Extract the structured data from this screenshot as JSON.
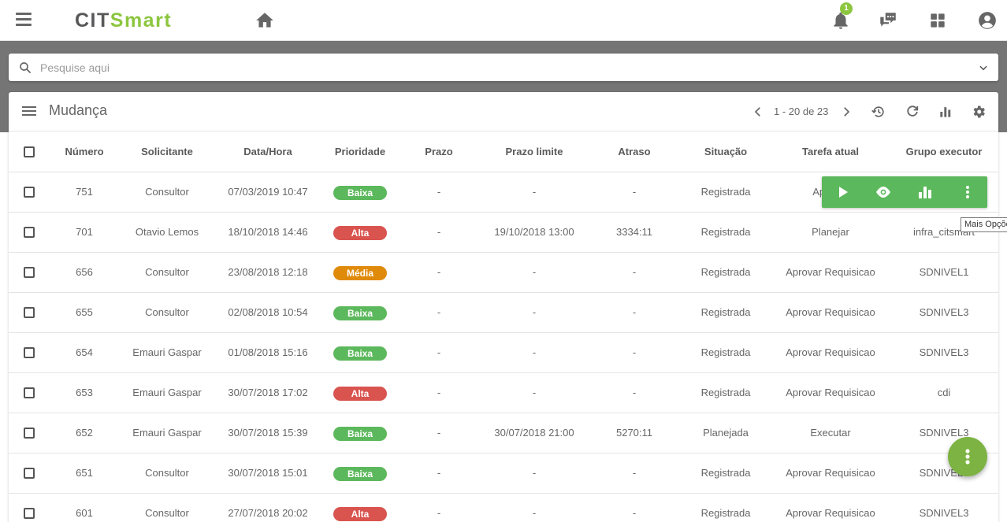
{
  "app": {
    "logo_part1": "CIT",
    "logo_part2": "Smart",
    "brand_color": "#8cc63f"
  },
  "topbar": {
    "notification_count": "1"
  },
  "search": {
    "placeholder": "Pesquise aqui"
  },
  "card": {
    "title": "Mudança",
    "pagination": "1 - 20 de 23"
  },
  "table": {
    "columns": [
      "Número",
      "Solicitante",
      "Data/Hora",
      "Prioridade",
      "Prazo",
      "Prazo limite",
      "Atraso",
      "Situação",
      "Tarefa atual",
      "Grupo executor"
    ],
    "priority_colors": {
      "Baixa": "#5cb85c",
      "Alta": "#d9534f",
      "Média": "#e08a0b"
    },
    "rows": [
      [
        "751",
        "Consultor",
        "07/03/2019 10:47",
        "Baixa",
        "-",
        "-",
        "-",
        "Registrada",
        "Aprovar",
        ""
      ],
      [
        "701",
        "Otavio Lemos",
        "18/10/2018 14:46",
        "Alta",
        "-",
        "19/10/2018 13:00",
        "3334:11",
        "Registrada",
        "Planejar",
        "infra_citsmart"
      ],
      [
        "656",
        "Consultor",
        "23/08/2018 12:18",
        "Média",
        "-",
        "-",
        "-",
        "Registrada",
        "Aprovar Requisicao",
        "SDNIVEL1"
      ],
      [
        "655",
        "Consultor",
        "02/08/2018 10:54",
        "Baixa",
        "-",
        "-",
        "-",
        "Registrada",
        "Aprovar Requisicao",
        "SDNIVEL3"
      ],
      [
        "654",
        "Emauri Gaspar",
        "01/08/2018 15:16",
        "Baixa",
        "-",
        "-",
        "-",
        "Registrada",
        "Aprovar Requisicao",
        "SDNIVEL3"
      ],
      [
        "653",
        "Emauri Gaspar",
        "30/07/2018 17:02",
        "Alta",
        "-",
        "-",
        "-",
        "Registrada",
        "Aprovar Requisicao",
        "cdi"
      ],
      [
        "652",
        "Emauri Gaspar",
        "30/07/2018 15:39",
        "Baixa",
        "-",
        "30/07/2018 21:00",
        "5270:11",
        "Planejada",
        "Executar",
        "SDNIVEL3"
      ],
      [
        "651",
        "Consultor",
        "30/07/2018 15:01",
        "Baixa",
        "-",
        "-",
        "-",
        "Registrada",
        "Aprovar Requisicao",
        "SDNIVEL3"
      ],
      [
        "601",
        "Consultor",
        "27/07/2018 20:02",
        "Alta",
        "-",
        "-",
        "-",
        "Registrada",
        "Aprovar Requisicao",
        "SDNIVEL3"
      ]
    ]
  },
  "action_bar": {
    "tooltip": "Mais Opções",
    "color": "#5cb85c"
  },
  "icons": {
    "topbar": [
      "menu-icon",
      "home-icon",
      "bell-icon",
      "chat-icon",
      "apps-grid-icon",
      "account-icon"
    ],
    "card_header": [
      "list-icon",
      "chevron-left-icon",
      "chevron-right-icon",
      "history-icon",
      "refresh-icon",
      "bar-chart-icon",
      "gear-icon"
    ],
    "action_bar": [
      "play-icon",
      "eye-icon",
      "bar-chart-icon",
      "more-vertical-icon"
    ],
    "fab": "more-vertical-icon"
  }
}
